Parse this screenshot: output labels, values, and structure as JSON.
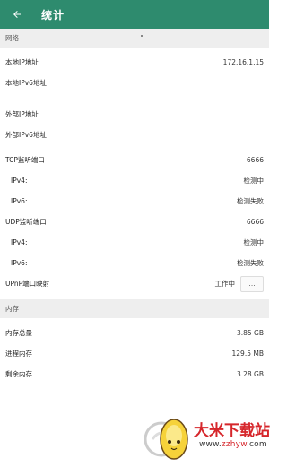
{
  "appbar": {
    "title": "统计",
    "back_icon": "arrow-left-icon",
    "background": "#2e8b6e"
  },
  "network": {
    "header": "网络",
    "local_ip": {
      "label": "本地IP地址",
      "value": "172.16.1.15"
    },
    "local_ipv6": {
      "label": "本地IPv6地址",
      "value": ""
    },
    "external_ip": {
      "label": "外部IP地址",
      "value": ""
    },
    "external_ipv6": {
      "label": "外部IPv6地址",
      "value": ""
    },
    "tcp": {
      "label": "TCP监听端口",
      "value": "6666",
      "ipv4": {
        "label": "IPv4:",
        "value": "检测中"
      },
      "ipv6": {
        "label": "IPv6:",
        "value": "检测失败"
      }
    },
    "udp": {
      "label": "UDP监听端口",
      "value": "6666",
      "ipv4": {
        "label": "IPv4:",
        "value": "检测中"
      },
      "ipv6": {
        "label": "IPv6:",
        "value": "检测失败"
      }
    },
    "upnp": {
      "label": "UPnP端口映射",
      "value": "工作中",
      "button": "..."
    }
  },
  "memory": {
    "header": "内存",
    "total": {
      "label": "内存总量",
      "value": "3.85 GB"
    },
    "process": {
      "label": "进程内存",
      "value": "129.5 MB"
    },
    "free": {
      "label": "剩余内存",
      "value": "3.28 GB"
    }
  },
  "watermark": {
    "name": "大米下载站",
    "url_prefix": "www.",
    "url_highlight": "zzhyw",
    "url_suffix": ".com",
    "brand_color": "#d6262b"
  }
}
